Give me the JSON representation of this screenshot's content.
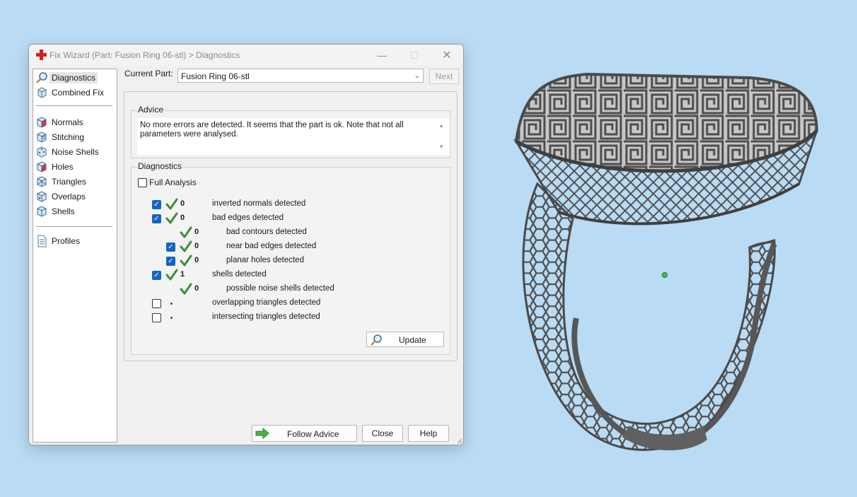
{
  "window": {
    "title": "Fix Wizard (Part: Fusion Ring 06-stl) > Diagnostics",
    "minimize_glyph": "—",
    "maximize_glyph": "☐",
    "close_glyph": "✕"
  },
  "nav": {
    "items": [
      {
        "label": "Diagnostics",
        "icon": "magnifier-icon",
        "selected": true
      },
      {
        "label": "Combined Fix",
        "icon": "combined-fix-icon"
      },
      {
        "label": "Normals",
        "icon": "normals-cube-icon"
      },
      {
        "label": "Stitching",
        "icon": "stitching-cube-icon"
      },
      {
        "label": "Noise Shells",
        "icon": "noise-shells-cube-icon"
      },
      {
        "label": "Holes",
        "icon": "holes-cube-icon"
      },
      {
        "label": "Triangles",
        "icon": "triangles-cube-icon"
      },
      {
        "label": "Overlaps",
        "icon": "overlaps-cube-icon"
      },
      {
        "label": "Shells",
        "icon": "shells-cube-icon"
      },
      {
        "label": "Profiles",
        "icon": "document-icon"
      }
    ]
  },
  "part_bar": {
    "label": "Current Part:",
    "value": "Fusion Ring 06-stl",
    "next_label": "Next"
  },
  "advice": {
    "title": "Advice",
    "text": "No more errors are detected. It seems that the part is ok. Note that not all parameters were analysed."
  },
  "diagnostics": {
    "title": "Diagnostics",
    "full_analysis_label": "Full Analysis",
    "full_analysis_checked": false,
    "rows": [
      {
        "checkbox": true,
        "checked": true,
        "status": "ok",
        "count": "0",
        "text": "inverted normals detected"
      },
      {
        "checkbox": true,
        "checked": true,
        "status": "ok",
        "count": "0",
        "text": "bad edges detected"
      },
      {
        "checkbox": false,
        "checked": false,
        "status": "ok",
        "count": "0",
        "text": "bad contours detected"
      },
      {
        "checkbox": true,
        "checked": true,
        "status": "ok",
        "count": "0",
        "text": "near bad edges detected"
      },
      {
        "checkbox": true,
        "checked": true,
        "status": "ok",
        "count": "0",
        "text": "planar holes detected"
      },
      {
        "checkbox": true,
        "checked": true,
        "status": "ok",
        "count": "1",
        "text": "shells detected"
      },
      {
        "checkbox": false,
        "checked": false,
        "status": "ok",
        "count": "0",
        "text": "possible noise shells detected"
      },
      {
        "checkbox": true,
        "checked": false,
        "status": "pending",
        "count": "",
        "text": "overlapping triangles detected"
      },
      {
        "checkbox": true,
        "checked": false,
        "status": "pending",
        "count": "",
        "text": "intersecting triangles detected"
      }
    ],
    "update_label": "Update"
  },
  "footer": {
    "follow_label": "Follow Advice",
    "close_label": "Close",
    "help_label": "Help"
  },
  "colors": {
    "background": "#b9dbf4",
    "checkbox_checked": "#1565c0",
    "ok_check": "#3d8f3d",
    "ring_metal": "#5d5d5d"
  }
}
